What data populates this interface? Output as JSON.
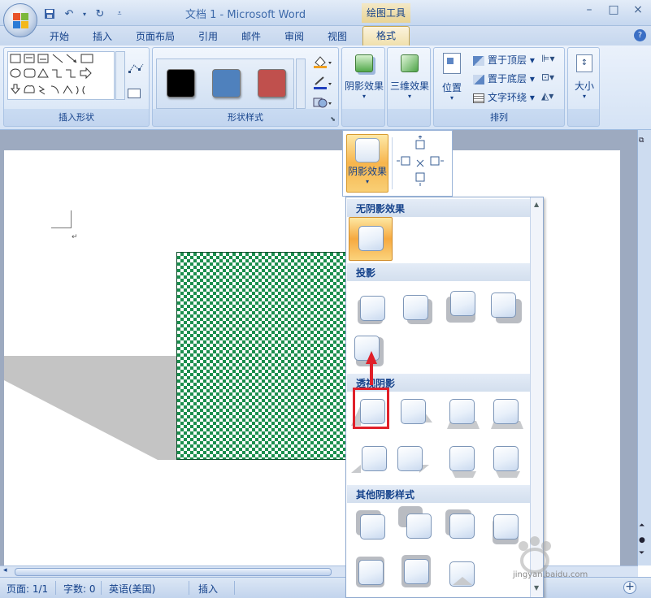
{
  "window": {
    "title": "文档 1 - Microsoft Word",
    "context_tab_group": "绘图工具",
    "controls": {
      "minimize": "–",
      "maximize": "□",
      "close": "×"
    }
  },
  "tabs": [
    {
      "label": "开始"
    },
    {
      "label": "插入"
    },
    {
      "label": "页面布局"
    },
    {
      "label": "引用"
    },
    {
      "label": "邮件"
    },
    {
      "label": "审阅"
    },
    {
      "label": "视图"
    },
    {
      "label": "格式",
      "active": true
    }
  ],
  "help": "?",
  "ribbon": {
    "insert_shapes": {
      "label": "插入形状"
    },
    "shape_styles": {
      "label": "形状样式",
      "swatch_colors": [
        "#000000",
        "#4f81bd",
        "#c0504d"
      ],
      "fill_color": "#f0a020",
      "line_color": "#1f3fbf"
    },
    "shadow_effects": {
      "label": "阴影效果"
    },
    "three_d_effects": {
      "label": "三维效果"
    },
    "arrange": {
      "label": "排列",
      "position": "位置",
      "bring_to_front": "置于顶层",
      "send_to_back": "置于底层",
      "text_wrapping": "文字环绕"
    },
    "size": {
      "label": "大小"
    }
  },
  "shadow_dropdown": {
    "button_label": "阴影效果",
    "sections": {
      "none": "无阴影效果",
      "drop": "投影",
      "perspective": "透视阴影",
      "other": "其他阴影样式"
    }
  },
  "document": {
    "shape_fill": "#1b8e4d",
    "shadow_color": "#c4c4c4",
    "para_mark": "↵"
  },
  "statusbar": {
    "page": "页面: 1/1",
    "words": "字数: 0",
    "language": "英语(美国)",
    "mode": "插入"
  },
  "watermark": {
    "brand": "Baidu 经验",
    "url": "jingyan.baidu.com"
  },
  "annotation_color": "#e0202a"
}
